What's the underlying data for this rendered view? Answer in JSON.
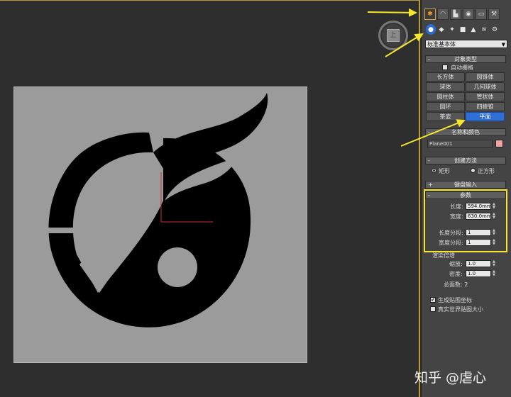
{
  "viewcube": {
    "face_label": "上"
  },
  "panel": {
    "tabs": [
      "create-tab",
      "modify-tab",
      "hierarchy-tab",
      "motion-tab",
      "display-tab",
      "utilities-tab"
    ],
    "dropdown": "标准基本体",
    "object_type": {
      "title": "对象类型",
      "autogrid": "自动栅格",
      "buttons": [
        "长方体",
        "圆锥体",
        "球体",
        "几何球体",
        "圆柱体",
        "管状体",
        "圆环",
        "四棱锥",
        "茶壶",
        "平面"
      ],
      "selected": "平面"
    },
    "name_color": {
      "title": "名称和颜色",
      "name": "Plane001",
      "color": "#f0a3a3"
    },
    "creation_method": {
      "title": "创建方法",
      "rect": "矩形",
      "square": "正方形"
    },
    "keyboard_entry": {
      "title": "键盘输入"
    },
    "parameters": {
      "title": "参数",
      "length_label": "长度:",
      "length_value": "594.0mm",
      "width_label": "宽度:",
      "width_value": "630.0mm",
      "length_segs_label": "长度分段:",
      "length_segs_value": "1",
      "width_segs_label": "宽度分段:",
      "width_segs_value": "1",
      "render_multipliers": "渲染倍增",
      "scale_label": "缩放:",
      "scale_value": "1.0",
      "density_label": "密度:",
      "density_value": "1.0",
      "total_faces": "总面数: 2",
      "gen_mapping": "生成贴图坐标",
      "real_world": "真实世界贴图大小"
    }
  },
  "watermark": "知乎 @虐心",
  "colors": {
    "accent": "#2f6fd6",
    "highlight": "#f5e62a",
    "border": "#b89a3a"
  }
}
